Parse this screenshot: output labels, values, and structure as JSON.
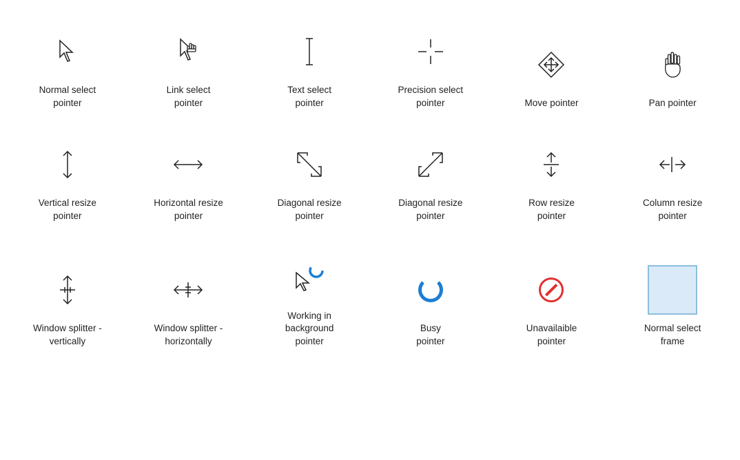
{
  "cells": [
    {
      "id": "normal-select",
      "label": "Normal select\npointer"
    },
    {
      "id": "link-select",
      "label": "Link select\npointer"
    },
    {
      "id": "text-select",
      "label": "Text select\npointer"
    },
    {
      "id": "precision-select",
      "label": "Precision select\npointer"
    },
    {
      "id": "move",
      "label": "Move pointer"
    },
    {
      "id": "pan",
      "label": "Pan pointer"
    },
    {
      "id": "vertical-resize",
      "label": "Vertical resize\npointer"
    },
    {
      "id": "horizontal-resize",
      "label": "Horizontal resize\npointer"
    },
    {
      "id": "diagonal-resize-1",
      "label": "Diagonal resize\npointer"
    },
    {
      "id": "diagonal-resize-2",
      "label": "Diagonal resize\npointer"
    },
    {
      "id": "row-resize",
      "label": "Row resize\npointer"
    },
    {
      "id": "column-resize",
      "label": "Column resize\npointer"
    },
    {
      "id": "window-splitter-v",
      "label": "Window splitter -\nvertically"
    },
    {
      "id": "window-splitter-h",
      "label": "Window splitter -\nhorizontally"
    },
    {
      "id": "working-bg",
      "label": "Working in\nbackground\npointer"
    },
    {
      "id": "busy",
      "label": "Busy\npointer"
    },
    {
      "id": "unavailable",
      "label": "Unavailaible\npointer"
    },
    {
      "id": "normal-frame",
      "label": "Normal select\nframe"
    }
  ]
}
